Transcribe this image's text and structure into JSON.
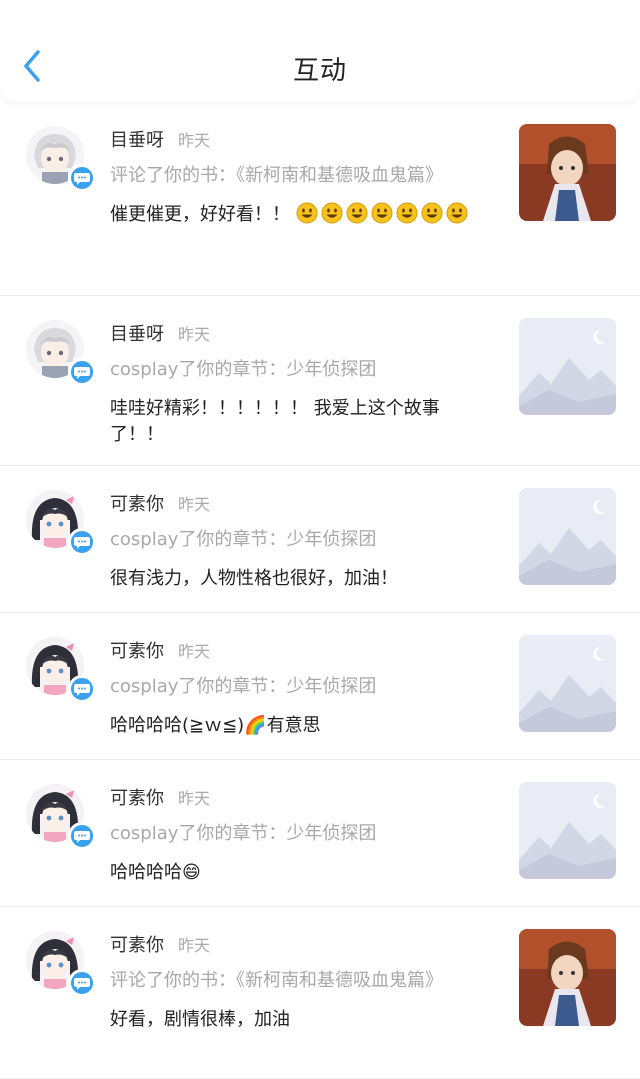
{
  "header": {
    "title": "互动"
  },
  "items": [
    {
      "name": "目垂呀",
      "time": "昨天",
      "action": "评论了你的书：《新柯南和基德吸血鬼篇》",
      "message": "催更催更，好好看！！",
      "smiley_count": 7,
      "avatar": "white-hair-character-avatar",
      "thumb": "book-cover-image"
    },
    {
      "name": "目垂呀",
      "time": "昨天",
      "action": "cosplay了你的章节：少年侦探团",
      "message": "哇哇好精彩！！！！！！ 我爱上这个故事了！！",
      "smiley_count": 0,
      "avatar": "white-hair-character-avatar",
      "thumb": "image-placeholder"
    },
    {
      "name": "可素你",
      "time": "昨天",
      "action": "cosplay了你的章节：少年侦探团",
      "message": "很有浅力，人物性格也很好，加油！",
      "smiley_count": 0,
      "avatar": "dark-hair-character-avatar",
      "thumb": "image-placeholder"
    },
    {
      "name": "可素你",
      "time": "昨天",
      "action": "cosplay了你的章节：少年侦探团",
      "message": "哈哈哈哈(≧ｗ≦)🌈有意思",
      "smiley_count": 0,
      "avatar": "dark-hair-character-avatar",
      "thumb": "image-placeholder"
    },
    {
      "name": "可素你",
      "time": "昨天",
      "action": "cosplay了你的章节：少年侦探团",
      "message": "哈哈哈哈😄",
      "smiley_count": 0,
      "avatar": "dark-hair-character-avatar",
      "thumb": "image-placeholder"
    },
    {
      "name": "可素你",
      "time": "昨天",
      "action": "评论了你的书：《新柯南和基德吸血鬼篇》",
      "message": "好看，剧情很棒，加油",
      "smiley_count": 0,
      "avatar": "dark-hair-character-avatar",
      "thumb": "book-cover-image"
    }
  ],
  "colors": {
    "accent": "#3aa0f0",
    "muted": "#a8a8a8",
    "text": "#222222"
  }
}
